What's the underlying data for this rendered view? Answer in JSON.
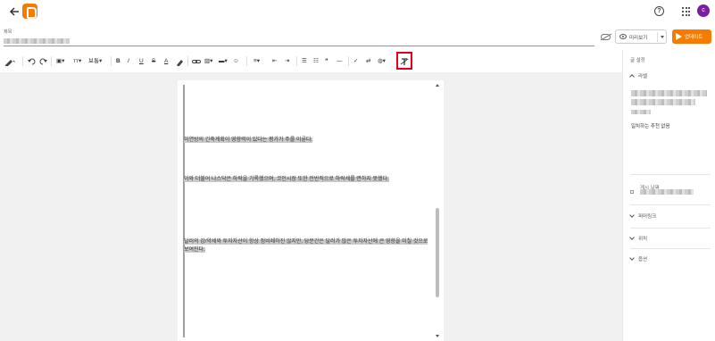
{
  "header": {
    "back_icon": "arrow-left-icon",
    "logo_icon": "blogger-logo-icon",
    "help_icon": "help-circle-icon",
    "apps_icon": "apps-grid-icon",
    "avatar_letter": "c",
    "avatar_color": "#7b1fa2",
    "brand_color": "#f57c00"
  },
  "title": {
    "label": "제목"
  },
  "actions": {
    "save_status_icon": "cloud-off-icon",
    "preview_label": "미리보기",
    "update_label": "업데이트"
  },
  "toolbar": {
    "font_label": "보통",
    "bold": "B",
    "italic": "I",
    "underline": "U",
    "strike": "S",
    "text_color": "A",
    "highlighted_tool_icon": "remove-formatting-icon"
  },
  "editor": {
    "paragraphs": [
      "미연방의 긴축계획이 영향력이 있다는 평가가 주를 이룬다.",
      "이와 더불어 나스닥은 하락을 기록했으며, 코인시장 또한 전반적으로 하락세를 면하지 못했다.",
      "달러의 강/약세와 투자자산이 항상 정비례하진 않지만, 당분간은 달러가 많은 투자자산에 큰 영향을 미칠 것으로 보여진다."
    ]
  },
  "sidebar": {
    "title": "글 설정",
    "labels_section": "라벨",
    "no_match": "일치하는 추천 없음",
    "post_date": "게시 날짜",
    "permalink": "퍼머링크",
    "location": "위치",
    "options": "옵션"
  }
}
